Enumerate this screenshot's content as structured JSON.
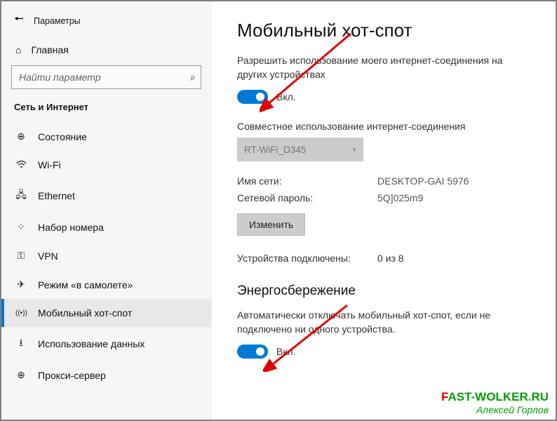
{
  "app": {
    "title": "Параметры"
  },
  "sidebar": {
    "home": "Главная",
    "search_placeholder": "Найти параметр",
    "category": "Сеть и Интернет",
    "items": [
      {
        "label": "Состояние",
        "icon": "⊕"
      },
      {
        "label": "Wi-Fi",
        "icon": "⚀"
      },
      {
        "label": "Ethernet",
        "icon": "⧉"
      },
      {
        "label": "Набор номера",
        "icon": "☎"
      },
      {
        "label": "VPN",
        "icon": "⚿"
      },
      {
        "label": "Режим «в самолете»",
        "icon": "✈"
      },
      {
        "label": "Мобильный хот-спот",
        "icon": "((•))"
      },
      {
        "label": "Использование данных",
        "icon": "⭳"
      },
      {
        "label": "Прокси-сервер",
        "icon": "⊕"
      }
    ],
    "selected_index": 6
  },
  "main": {
    "title": "Мобильный хот-спот",
    "share_caption": "Разрешить использование моего интернет-соединения на других устройствах",
    "toggle1_label": "Вкл.",
    "share_conn_label": "Совместное использование интернет-соединения",
    "conn_value": "RT-WiFi_D345",
    "net_name_label": "Имя сети:",
    "net_name_value": "DESKTOP-GAI 5976",
    "net_pass_label": "Сетевой пароль:",
    "net_pass_value": "5Q]025m9",
    "edit_btn": "Изменить",
    "devices_label": "Устройства подключены:",
    "devices_value": "0 из 8",
    "energy_head": "Энергосбережение",
    "energy_caption": "Автоматически отключать мобильный хот-спот, если не подключено ни одного устройства.",
    "toggle2_label": "Вкл."
  },
  "watermark": {
    "line1_f": "F",
    "line1_rest": "AST-WOLKER.RU",
    "line2": "Алексей Горлов"
  }
}
